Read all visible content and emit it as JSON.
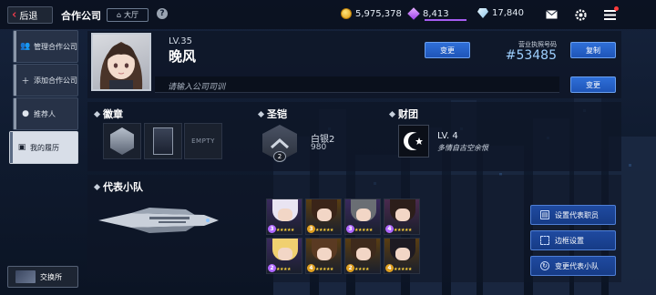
{
  "topbar": {
    "back_label": "后退",
    "title": "合作公司",
    "hall_label": "大厅",
    "help_glyph": "?",
    "coins": "5,975,378",
    "gems": "8,413",
    "diamonds": "17,840"
  },
  "sidebar": {
    "items": [
      {
        "label": "管理合作公司",
        "icon": "users-icon",
        "active": false
      },
      {
        "label": "添加合作公司",
        "icon": "add-user-icon",
        "active": false
      },
      {
        "label": "推荐人",
        "icon": "person-icon",
        "active": false
      },
      {
        "label": "我的履历",
        "icon": "profile-card-icon",
        "active": true
      }
    ],
    "exchange_label": "交换所"
  },
  "profile": {
    "level": "LV.35",
    "name": "晚风",
    "change_label": "变更",
    "license_label": "营业执照号码",
    "license_number": "#53485",
    "copy_label": "复制",
    "motto_placeholder": "请输入公司司训",
    "motto_change_label": "变更"
  },
  "badges": {
    "title": "徽章",
    "slots": [
      "",
      "",
      "EMPTY"
    ]
  },
  "armor": {
    "title": "圣铠",
    "rank": "白银2",
    "rank_level": "2",
    "points": "980"
  },
  "guild": {
    "title": "财团",
    "level": "LV. 4",
    "name": "多情自古空余恨"
  },
  "squad": {
    "title": "代表小队",
    "members": [
      {
        "level": "3",
        "stars": "★★★★★",
        "hair": "#e9e4f2",
        "bg": "#3a2a5e",
        "lvcolor": "#b068ff"
      },
      {
        "level": "3",
        "stars": "★★★★★",
        "hair": "#3a2418",
        "bg": "#5a3e12",
        "lvcolor": "#e0a020"
      },
      {
        "level": "3",
        "stars": "★★★★★",
        "hair": "#6a6e74",
        "bg": "#3a2a5e",
        "lvcolor": "#b068ff"
      },
      {
        "level": "4",
        "stars": "★★★★★",
        "hair": "#2c1e1a",
        "bg": "#4a2a4e",
        "lvcolor": "#b068ff"
      },
      {
        "level": "2",
        "stars": "★★★★",
        "hair": "#f0d070",
        "bg": "#3a2a5e",
        "lvcolor": "#b068ff"
      },
      {
        "level": "4",
        "stars": "★★★★★",
        "hair": "#5a3a22",
        "bg": "#5a3e12",
        "lvcolor": "#e0a020"
      },
      {
        "level": "2",
        "stars": "★★★★",
        "hair": "#3e2a1c",
        "bg": "#5a3e12",
        "lvcolor": "#e0a020"
      },
      {
        "level": "4",
        "stars": "★★★★★",
        "hair": "#1e1a22",
        "bg": "#5a3e12",
        "lvcolor": "#e0a020"
      }
    ]
  },
  "actions": {
    "set_rep_staff": "设置代表职员",
    "frame_settings": "边框设置",
    "change_rep_squad": "变更代表小队"
  }
}
